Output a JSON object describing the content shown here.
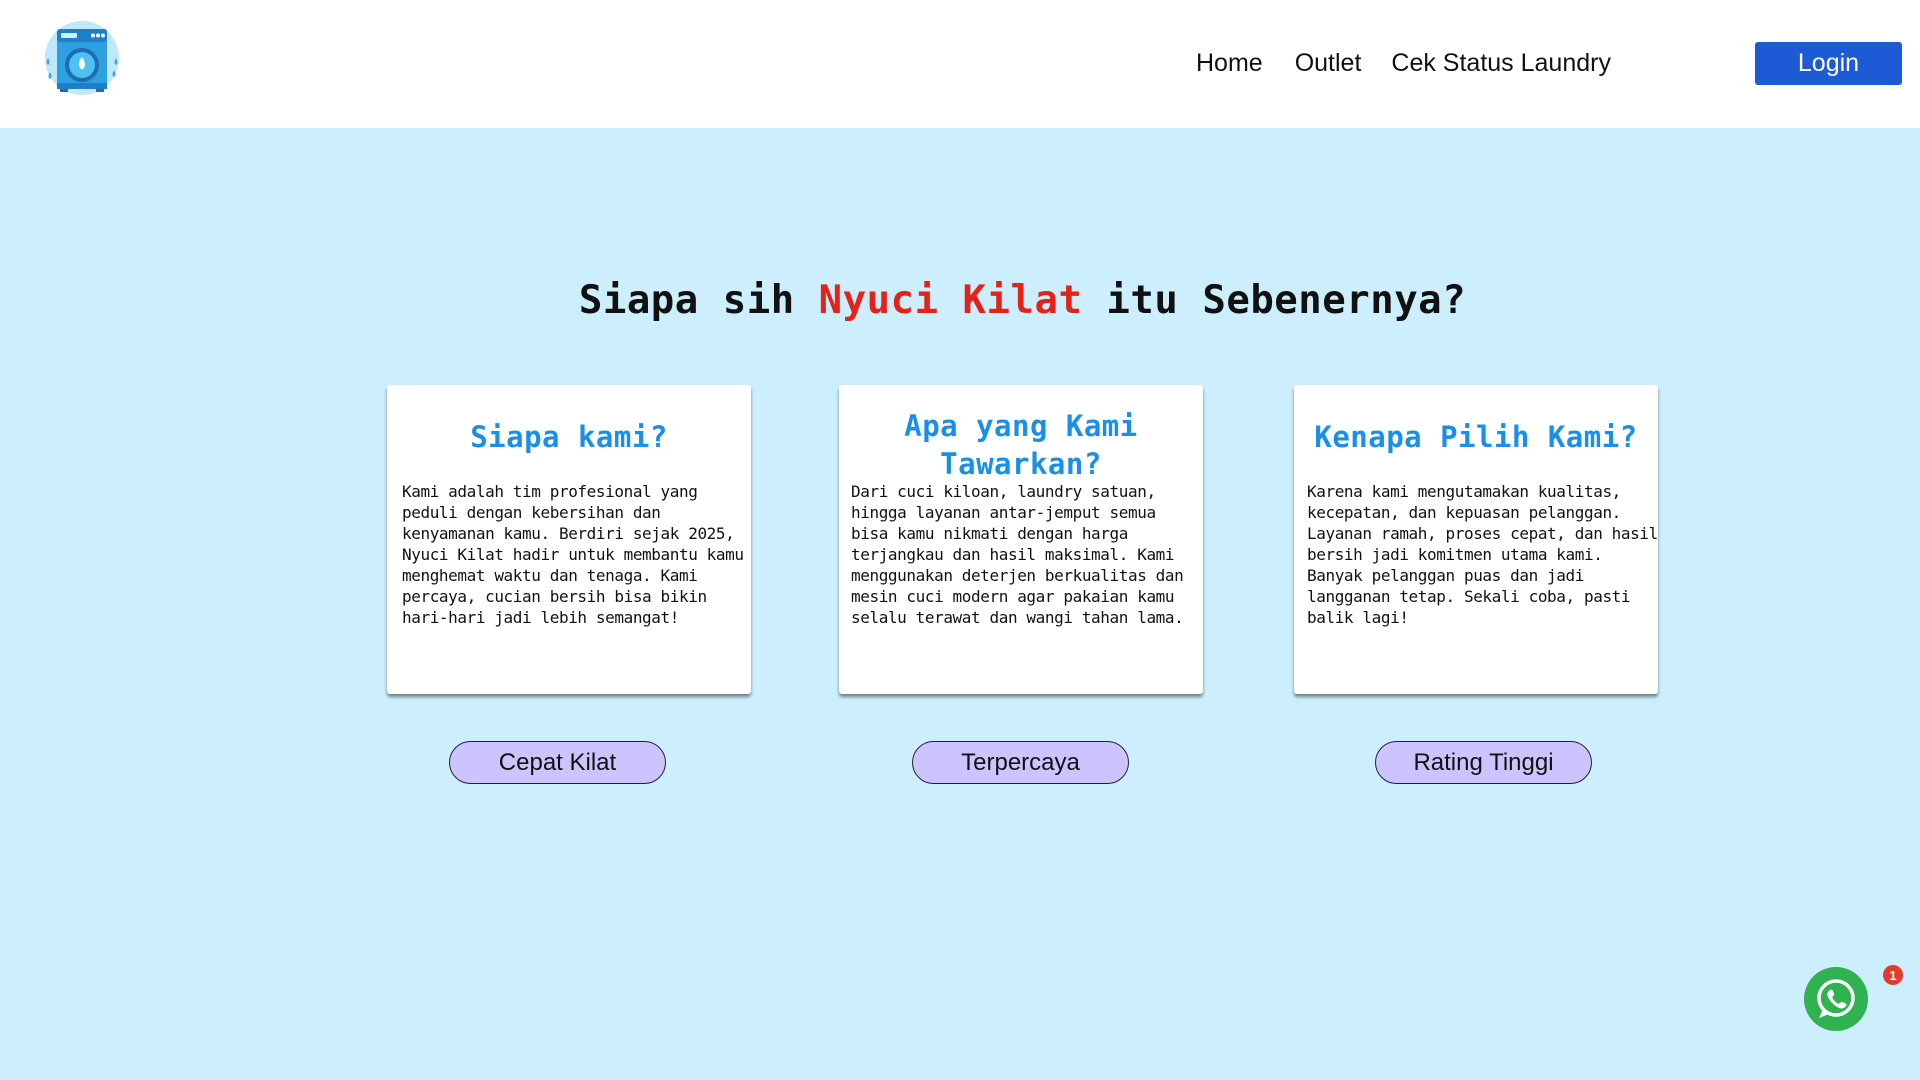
{
  "header": {
    "logo_icon": "washing-machine-icon",
    "nav": {
      "home": "Home",
      "outlet": "Outlet",
      "status": "Cek Status Laundry"
    },
    "login_label": "Login"
  },
  "hero": {
    "title_before": "Siapa sih ",
    "title_brand": "Nyuci Kilat",
    "title_after": " itu Sebenernya?"
  },
  "cards": [
    {
      "title": "Siapa kami?",
      "text": "Kami adalah tim profesional yang peduli dengan kebersihan dan kenyamanan kamu. Berdiri sejak 2025, Nyuci Kilat hadir untuk membantu kamu menghemat waktu dan tenaga. Kami percaya, cucian bersih bisa bikin hari-hari jadi lebih semangat!"
    },
    {
      "title": "Apa yang Kami Tawarkan?",
      "text": "Dari cuci kiloan, laundry satuan, hingga layanan antar-jemput semua bisa kamu nikmati dengan harga terjangkau dan hasil maksimal. Kami menggunakan deterjen berkualitas dan mesin cuci modern agar pakaian kamu selalu terawat dan wangi tahan lama."
    },
    {
      "title": "Kenapa Pilih Kami?",
      "text": "Karena kami mengutamakan kualitas, kecepatan, dan kepuasan pelanggan. Layanan ramah, proses cepat, dan hasil bersih jadi komitmen utama kami. Banyak pelanggan puas dan jadi langganan tetap. Sekali coba, pasti balik lagi!"
    }
  ],
  "badges": [
    "Cepat Kilat",
    "Terpercaya",
    "Rating Tinggi"
  ],
  "whatsapp": {
    "icon": "whatsapp-icon",
    "notification_count": "1"
  },
  "colors": {
    "background": "#cdeffd",
    "brand_red": "#e52219",
    "card_title_blue": "#1a8fe8",
    "login_blue": "#1d5bd6",
    "pill_lavender": "#cdc4ff",
    "whatsapp_green": "#2fb24f"
  }
}
